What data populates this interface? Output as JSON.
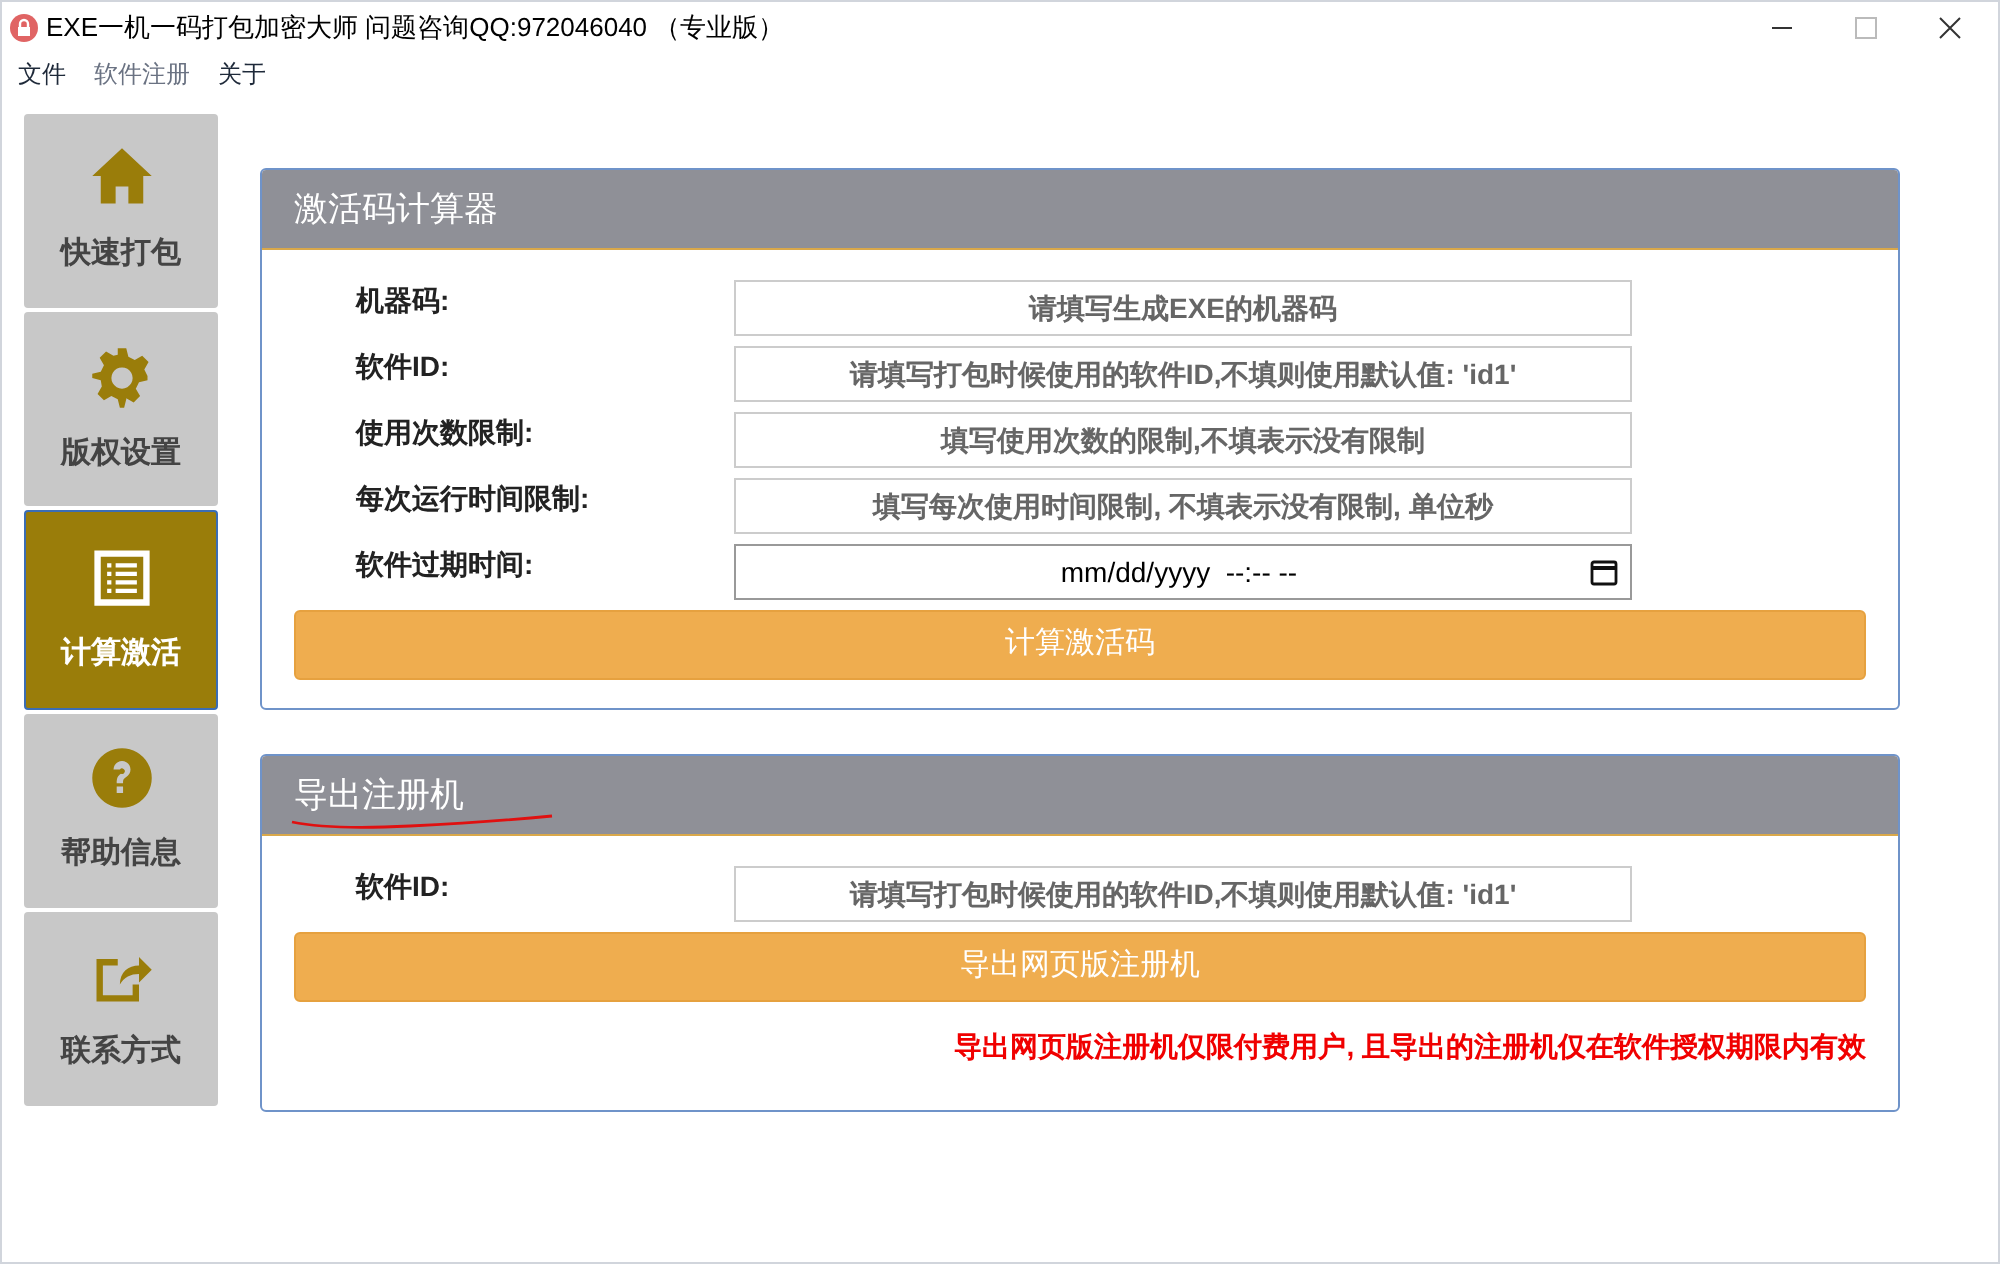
{
  "window": {
    "title": "EXE一机一码打包加密大师 问题咨询QQ:972046040 （专业版）"
  },
  "menu": [
    {
      "label": "文件",
      "disabled": false
    },
    {
      "label": "软件注册",
      "disabled": true
    },
    {
      "label": "关于",
      "disabled": false
    }
  ],
  "sidebar": {
    "items": [
      {
        "label": "快速打包",
        "kind": "home",
        "selected": false
      },
      {
        "label": "版权设置",
        "kind": "gear",
        "selected": false
      },
      {
        "label": "计算激活",
        "kind": "list",
        "selected": true
      },
      {
        "label": "帮助信息",
        "kind": "help",
        "selected": false
      },
      {
        "label": "联系方式",
        "kind": "share",
        "selected": false
      }
    ]
  },
  "panels": [
    {
      "title": "激活码计算器",
      "underlined": false,
      "fields": [
        {
          "label": "机器码:",
          "kind": "text",
          "placeholder": "请填写生成EXE的机器码"
        },
        {
          "label": "软件ID:",
          "kind": "text",
          "placeholder": "请填写打包时候使用的软件ID,不填则使用默认值: 'id1'"
        },
        {
          "label": "使用次数限制:",
          "kind": "text",
          "placeholder": "填写使用次数的限制,不填表示没有限制"
        },
        {
          "label": "每次运行时间限制:",
          "kind": "text",
          "placeholder": "填写每次使用时间限制, 不填表示没有限制, 单位秒"
        },
        {
          "label": "软件过期时间:",
          "kind": "datetime",
          "value": "mm/dd/yyyy  --:-- --"
        }
      ],
      "button": "计算激活码"
    },
    {
      "title": "导出注册机",
      "underlined": true,
      "fields": [
        {
          "label": "软件ID:",
          "kind": "text",
          "placeholder": "请填写打包时候使用的软件ID,不填则使用默认值: 'id1'"
        }
      ],
      "button": "导出网页版注册机",
      "note": "导出网页版注册机仅限付费用户, 且导出的注册机仅在软件授权期限内有效"
    }
  ]
}
